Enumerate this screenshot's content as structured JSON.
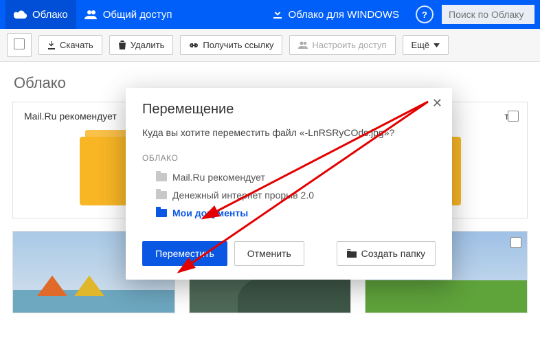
{
  "topbar": {
    "cloud_label": "Облако",
    "share_label": "Общий доступ",
    "windows_label": "Облако для WINDOWS",
    "search_placeholder": "Поиск по Облаку"
  },
  "toolbar": {
    "download": "Скачать",
    "delete": "Удалить",
    "get_link": "Получить ссылку",
    "configure_access": "Настроить доступ",
    "more": "Ещё"
  },
  "section": {
    "title": "Облако"
  },
  "folders": [
    {
      "label": "Mail.Ru рекомендует"
    },
    {
      "label": "ты"
    }
  ],
  "modal": {
    "title": "Перемещение",
    "question_prefix": "Куда вы хотите переместить файл «",
    "filename": "-LnRSRyCOds.jpg",
    "question_suffix": "»?",
    "tree_header": "ОБЛАКО",
    "tree": [
      {
        "label": "Mail.Ru рекомендует",
        "selected": false
      },
      {
        "label": "Денежный интернет прорыв 2.0",
        "selected": false
      },
      {
        "label": "Мои документы",
        "selected": true
      }
    ],
    "move_btn": "Переместить",
    "cancel_btn": "Отменить",
    "new_folder_btn": "Создать папку"
  }
}
